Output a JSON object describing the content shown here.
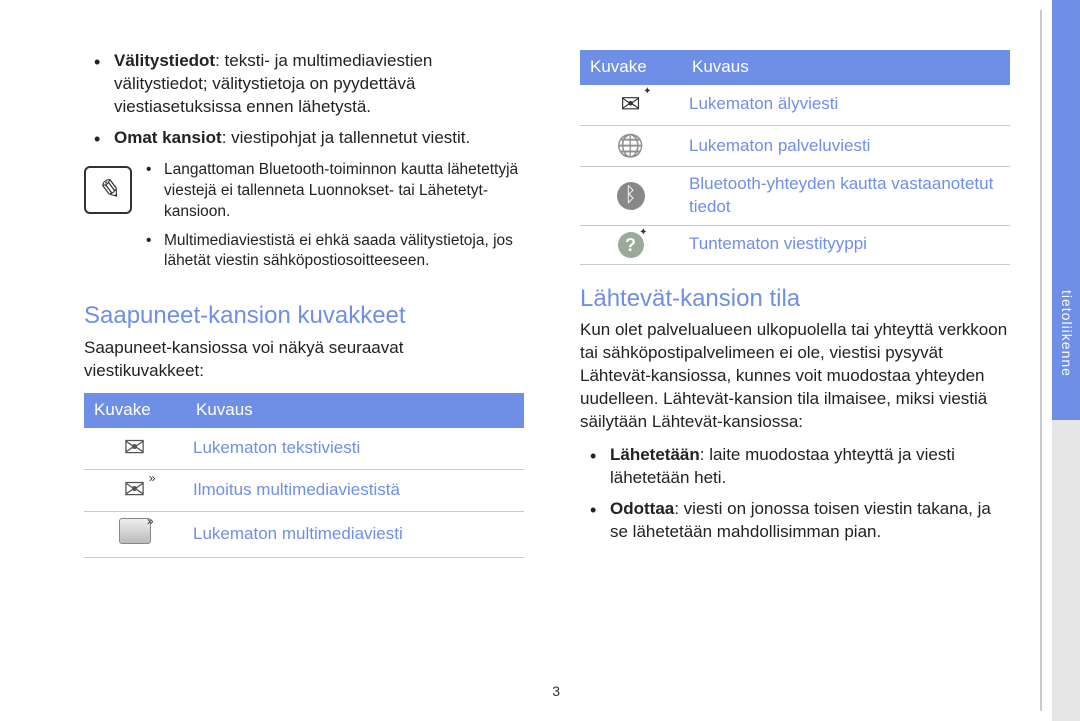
{
  "left": {
    "bullets": [
      {
        "bold": "Välitystiedot",
        "text": ": teksti- ja multimediaviestien välitystiedot; välitystietoja on pyydettävä viestiasetuksissa ennen lähetystä."
      },
      {
        "bold": "Omat kansiot",
        "text": ": viestipohjat ja tallennetut viestit."
      }
    ],
    "notes": [
      "Langattoman Bluetooth-toiminnon kautta lähetettyjä viestejä ei tallenneta Luonnokset- tai Lähetetyt-kansioon.",
      "Multimediaviestistä ei ehkä saada välitystietoja, jos lähetät viestin sähköpostiosoitteeseen."
    ],
    "section_title": "Saapuneet-kansion kuvakkeet",
    "section_intro": "Saapuneet-kansiossa voi näkyä seuraavat viestikuvakkeet:",
    "table_head_icon": "Kuvake",
    "table_head_desc": "Kuvaus",
    "rows": [
      {
        "icon": "env",
        "desc": "Lukematon tekstiviesti"
      },
      {
        "icon": "env mm",
        "desc": "Ilmoitus multimediaviestistä"
      },
      {
        "icon": "photo",
        "desc": "Lukematon multimediaviesti"
      }
    ]
  },
  "right": {
    "table_head_icon": "Kuvake",
    "table_head_desc": "Kuvaus",
    "rows": [
      {
        "icon": "house",
        "desc": "Lukematon älyviesti"
      },
      {
        "icon": "globe",
        "desc": "Lukematon palveluviesti"
      },
      {
        "icon": "bt",
        "desc": "Bluetooth-yhteyden kautta vastaanotetut tiedot"
      },
      {
        "icon": "q",
        "desc": "Tuntematon viestityyppi"
      }
    ],
    "section_title": "Lähtevät-kansion tila",
    "section_body": "Kun olet palvelualueen ulkopuolella tai yhteyttä verkkoon tai sähköpostipalvelimeen ei ole, viestisi pysyvät Lähtevät-kansiossa, kunnes voit muodostaa yhteyden uudelleen. Lähtevät-kansion tila ilmaisee, miksi viestiä säilytään Lähtevät-kansiossa:",
    "bullets": [
      {
        "bold": "Lähetetään",
        "text": ": laite muodostaa yhteyttä ja viesti lähetetään heti."
      },
      {
        "bold": "Odottaa",
        "text": ": viesti on jonossa toisen viestin takana, ja se lähetetään mahdollisimman pian."
      }
    ]
  },
  "side_label": "tietoliikenne",
  "page_number": "3"
}
